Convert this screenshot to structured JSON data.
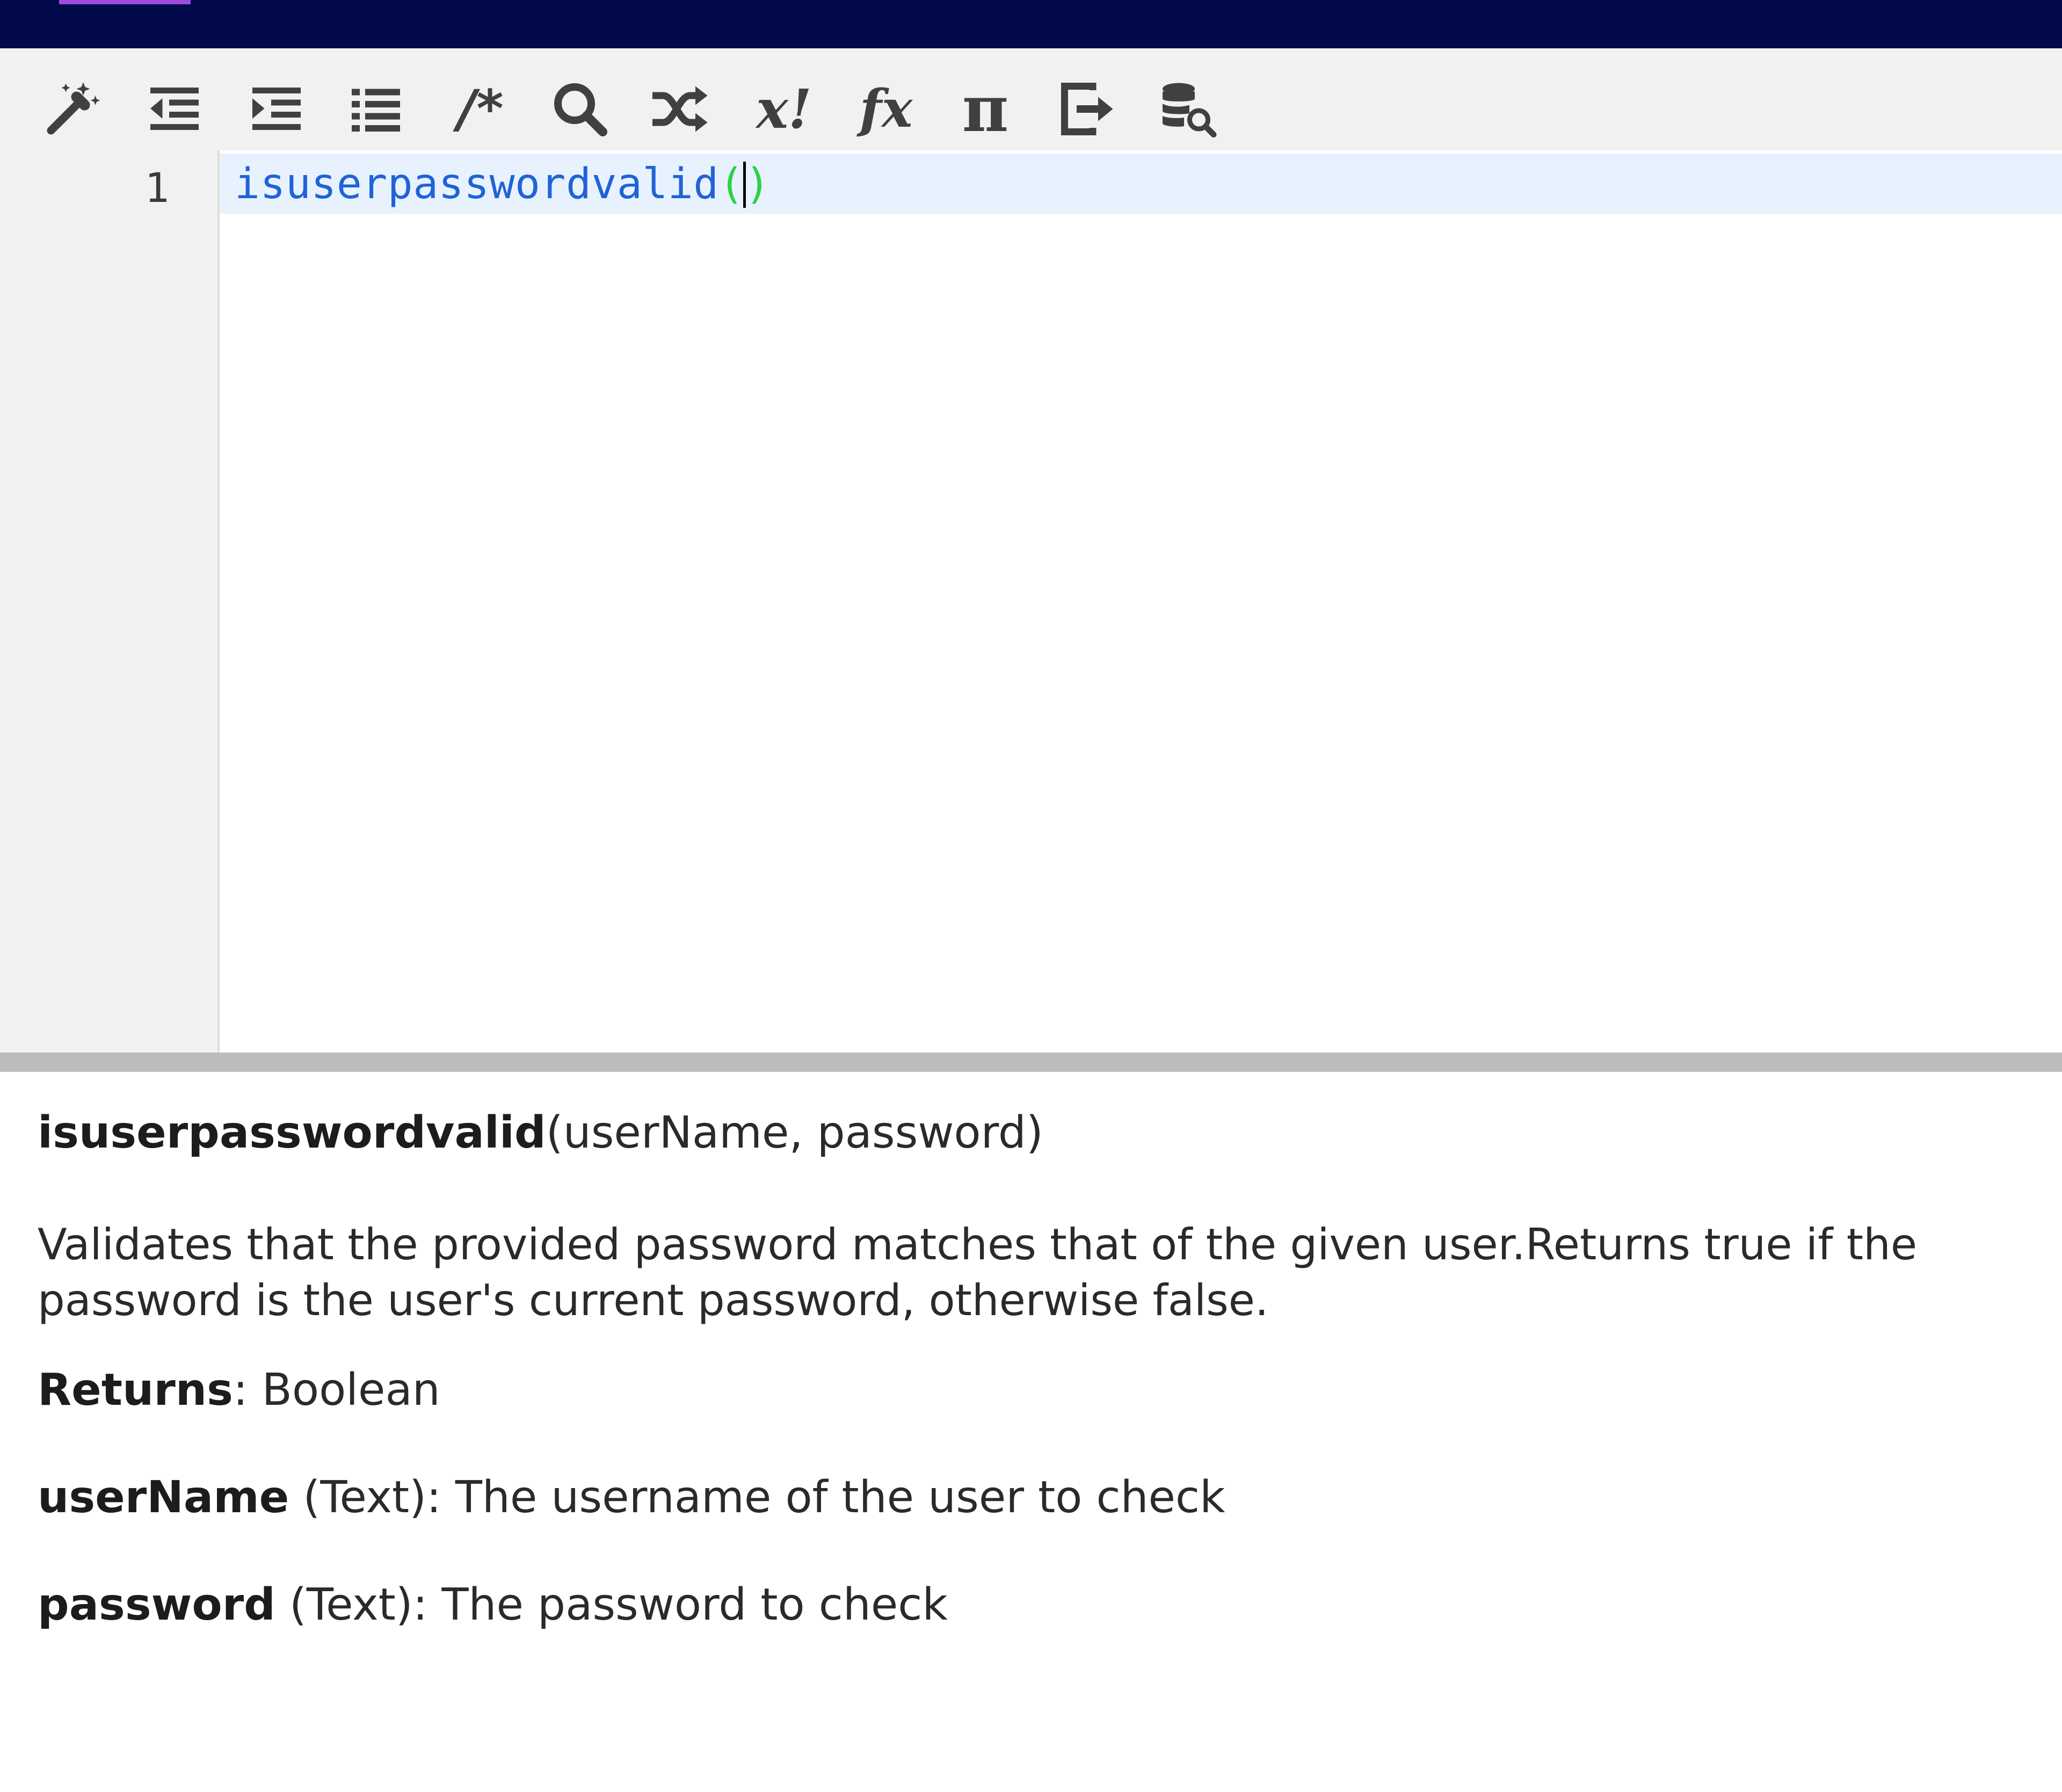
{
  "colors": {
    "topbar": "#020a4c",
    "topbar_accent": "#9c4ddb",
    "function_token": "#1f63d6",
    "paren_token": "#2bd14a",
    "active_line": "#e8f2fe"
  },
  "toolbar": {
    "items": [
      {
        "icon": "magic-wand-icon"
      },
      {
        "icon": "outdent-icon"
      },
      {
        "icon": "indent-icon"
      },
      {
        "icon": "list-icon"
      },
      {
        "icon": "comment-icon",
        "glyph": "/*"
      },
      {
        "icon": "search-icon"
      },
      {
        "icon": "shuffle-icon"
      },
      {
        "icon": "factorial-icon",
        "glyph": "x!"
      },
      {
        "icon": "function-icon",
        "glyph": "fx"
      },
      {
        "icon": "pi-icon",
        "glyph": "π"
      },
      {
        "icon": "export-icon"
      },
      {
        "icon": "database-search-icon"
      }
    ]
  },
  "editor": {
    "line_number": "1",
    "function_name": "isuserpasswordvalid",
    "open_paren": "(",
    "close_paren": ")"
  },
  "help": {
    "signature_name": "isuserpasswordvalid",
    "signature_params": "(userName, password)",
    "description": "Validates that the provided password matches that of the given user.Returns true if the password is the user's current password, otherwise false.",
    "returns_label": "Returns",
    "returns_value": ": Boolean",
    "params": [
      {
        "name": "userName",
        "detail": " (Text): The username of the user to check"
      },
      {
        "name": "password",
        "detail": " (Text): The password to check"
      }
    ]
  }
}
